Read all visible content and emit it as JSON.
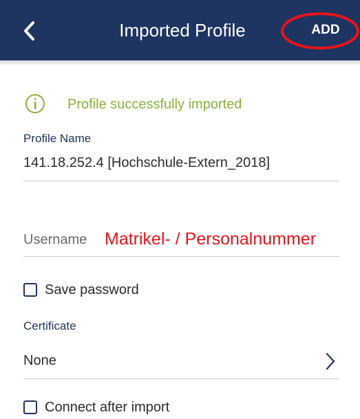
{
  "header": {
    "title": "Imported Profile",
    "add_label": "ADD",
    "back_icon": "chevron-left-icon"
  },
  "notice": {
    "icon": "info-icon",
    "text": "Profile successfully imported"
  },
  "profile_name": {
    "label": "Profile Name",
    "value": "141.18.252.4 [Hochschule-Extern_2018]"
  },
  "username": {
    "label": "Username",
    "hint": "Matrikel- / Personalnummer"
  },
  "save_password": {
    "label": "Save password",
    "checked": false
  },
  "certificate": {
    "label": "Certificate",
    "value": "None",
    "chevron_icon": "chevron-right-icon"
  },
  "connect_after_import": {
    "label": "Connect after import",
    "checked": false
  },
  "colors": {
    "header_bg": "#1e3461",
    "success": "#8bb23a",
    "annotation_red": "#e8141b"
  }
}
